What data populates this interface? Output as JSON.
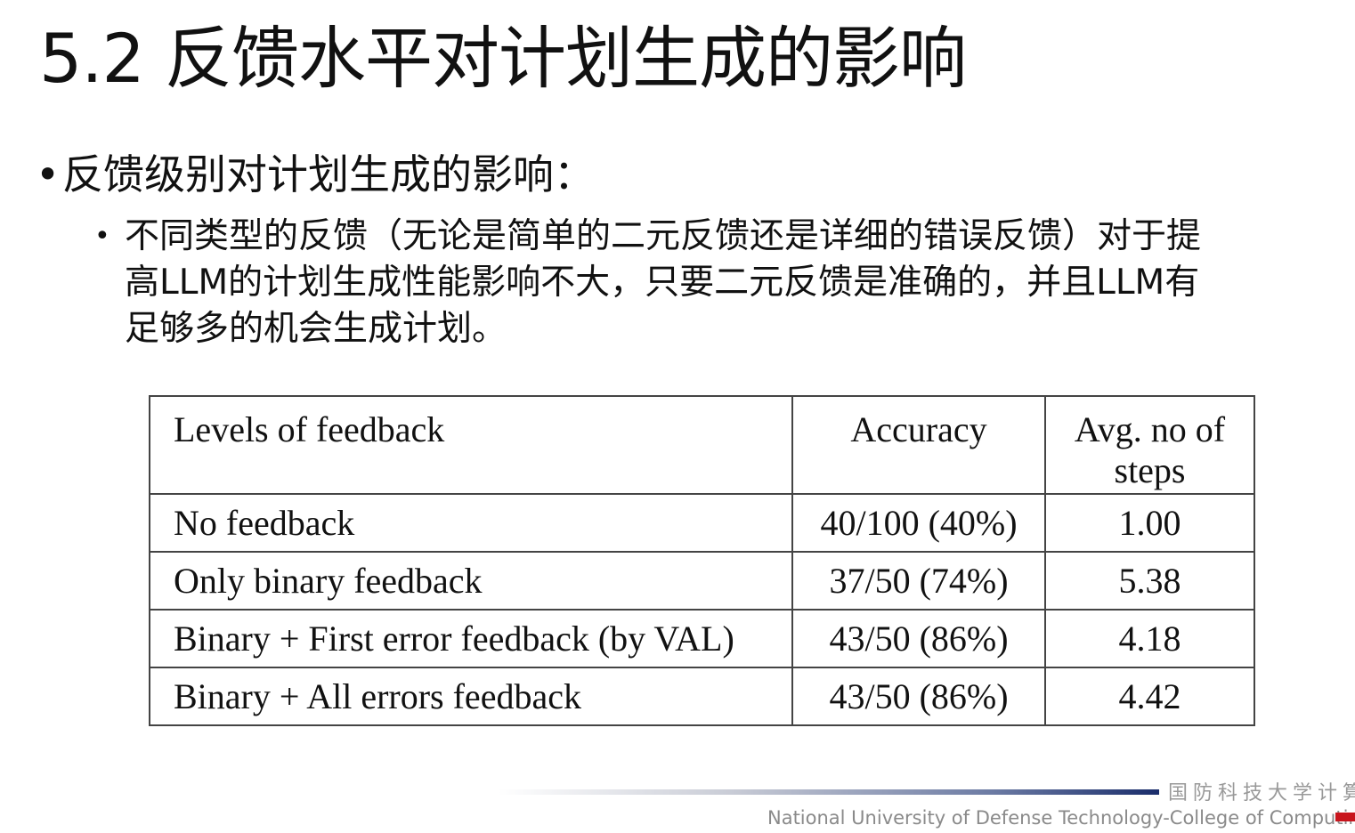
{
  "slide": {
    "title": "5.2 反馈水平对计划生成的影响"
  },
  "bullets": {
    "level1": "反馈级别对计划生成的影响：",
    "level2_lines": [
      "不同类型的反馈（无论是简单的二元反馈还是详细的错误反馈）对于提",
      "高LLM的计划生成性能影响不大，只要二元反馈是准确的，并且LLM有",
      "足够多的机会生成计划。"
    ]
  },
  "table": {
    "headers": [
      "Levels of feedback",
      "Accuracy",
      "Avg. no of steps"
    ],
    "rows": [
      [
        "No feedback",
        "40/100 (40%)",
        "1.00"
      ],
      [
        "Only binary feedback",
        "37/50 (74%)",
        "5.38"
      ],
      [
        "Binary + First error feedback (by VAL)",
        "43/50 (86%)",
        "4.18"
      ],
      [
        "Binary + All errors feedback",
        "43/50 (86%)",
        "4.42"
      ]
    ]
  },
  "footer": {
    "cn": "国防科技大学计算机",
    "en": "National University of Defense Technology-College of Computing"
  },
  "colors": {
    "footer_accent": "#1a2d6b",
    "footer_red": "#c8151d"
  }
}
